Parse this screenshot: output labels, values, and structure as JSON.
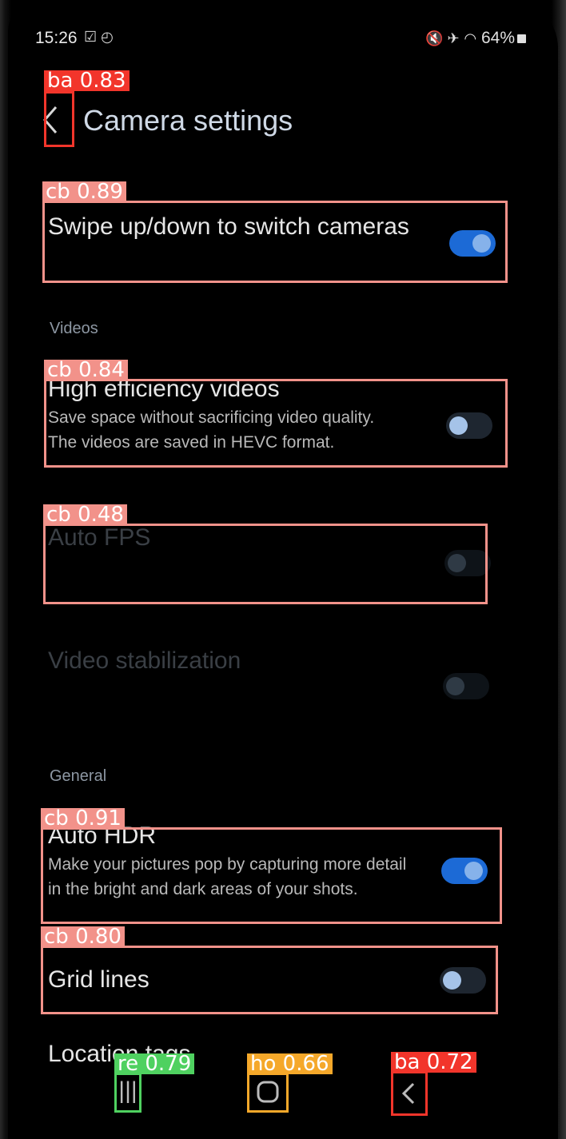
{
  "status_bar": {
    "time": "15:26",
    "left_icons": "☑ ◴",
    "battery": "64%",
    "right_icons": "🔇 ✈"
  },
  "header": {
    "title": "Camera settings"
  },
  "settings": {
    "swipe": {
      "title": "Swipe up/down to switch cameras",
      "toggle": "on"
    },
    "videos_header": "Videos",
    "hev": {
      "title": "High efficiency videos",
      "desc": "Save space without sacrificing video quality. The videos are saved in HEVC format.",
      "toggle": "off"
    },
    "auto_fps": {
      "title": "Auto FPS",
      "toggle": "disabled"
    },
    "stabilization": {
      "title": "Video stabilization",
      "toggle": "disabled"
    },
    "general_header": "General",
    "hdr": {
      "title": "Auto HDR",
      "desc": "Make your pictures pop by capturing more detail in the bright and dark areas of your shots.",
      "toggle": "on"
    },
    "grid": {
      "title": "Grid lines",
      "toggle": "off"
    },
    "location": {
      "title": "Location tags"
    }
  },
  "detections": [
    {
      "label": "ba 0.83"
    },
    {
      "label": "cb 0.89"
    },
    {
      "label": "cb 0.84"
    },
    {
      "label": "cb 0.48"
    },
    {
      "label": "cb 0.91"
    },
    {
      "label": "cb 0.80"
    },
    {
      "label": "re 0.79"
    },
    {
      "label": "ho 0.66"
    },
    {
      "label": "ba 0.72"
    }
  ],
  "colors": {
    "toggle_on": "#1c6ad6",
    "box": "#f2928a",
    "tag_red": "#f2352b",
    "tag_green": "#4fd160",
    "tag_orange": "#f5a82a"
  }
}
